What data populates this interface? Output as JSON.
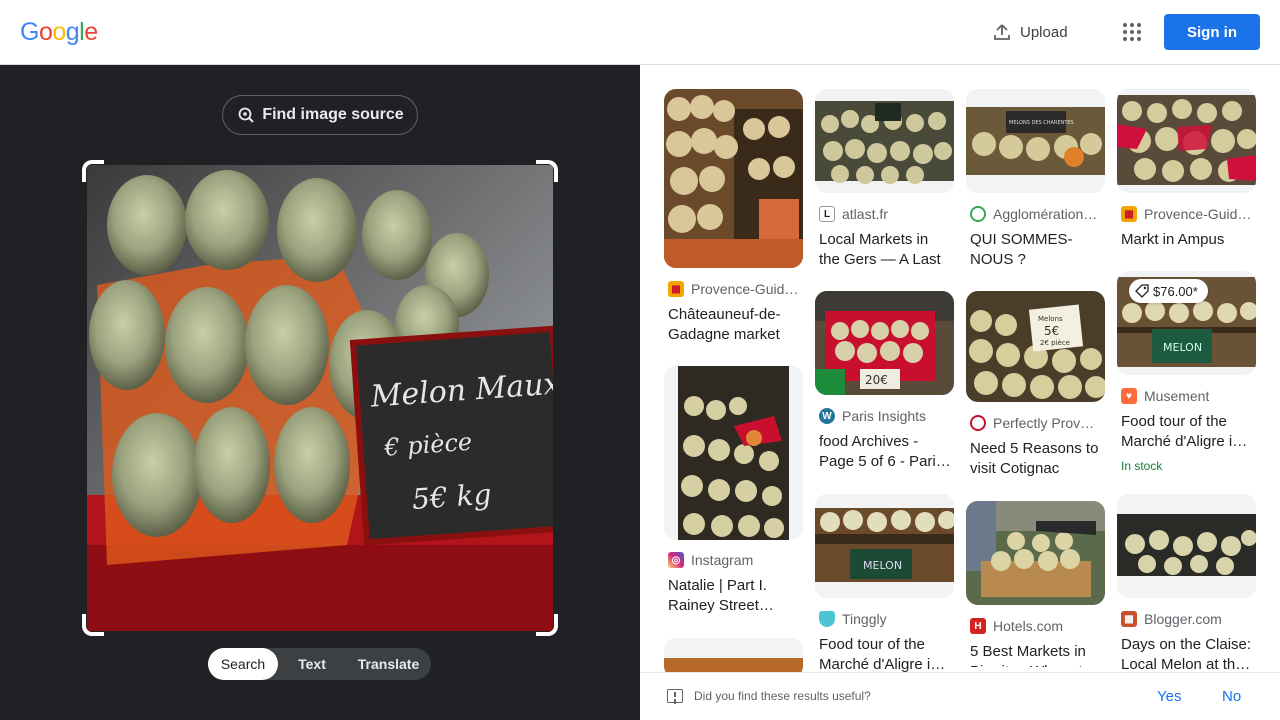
{
  "header": {
    "logo_letters": [
      "G",
      "o",
      "o",
      "g",
      "l",
      "e"
    ],
    "logo_colors": [
      "#4285f4",
      "#ea4335",
      "#fbbc05",
      "#4285f4",
      "#34a853",
      "#ea4335"
    ],
    "upload_label": "Upload",
    "signin_label": "Sign in",
    "accent": "#1a73e8"
  },
  "viewer": {
    "find_source_label": "Find image source",
    "tabs": [
      "Search",
      "Text",
      "Translate"
    ],
    "active_tab": "Search",
    "sign_text": [
      "Melon Maux",
      "€ pièce",
      "5€ kg"
    ]
  },
  "results": [
    {
      "source": "Provence-Guid…",
      "title": "Châteauneuf-de-Gadagne market",
      "favicon": "provence-guide-icon"
    },
    {
      "source": "atlast.fr",
      "title": "Local Markets in the Gers — A Last",
      "favicon": "atlast-icon"
    },
    {
      "source": "Agglomération…",
      "title": "QUI SOMMES-NOUS ?",
      "favicon": "agglomeration-icon"
    },
    {
      "source": "Provence-Guid…",
      "title": "Markt in Ampus",
      "favicon": "provence-guide-icon"
    },
    {
      "source": "Paris Insights",
      "title": "food Archives - Page 5 of 6 - Pari…",
      "favicon": "wordpress-icon"
    },
    {
      "source": "Perfectly Prov…",
      "title": "Need 5 Reasons to visit Cotignac",
      "favicon": "perfectly-provence-icon"
    },
    {
      "source": "Musement",
      "title": "Food tour of the Marché d'Aligre i…",
      "favicon": "musement-heart-icon",
      "price": "$76.00*",
      "stock": "In stock"
    },
    {
      "source": "Instagram",
      "title": "Natalie | Part I. Rainey Street…",
      "favicon": "instagram-icon"
    },
    {
      "source": "Tinggly",
      "title": "Food tour of the Marché d'Aligre i…",
      "favicon": "tinggly-icon"
    },
    {
      "source": "Hotels.com",
      "title": "5 Best Markets in Biarritz - Where t…",
      "favicon": "hotels-icon"
    },
    {
      "source": "Blogger.com",
      "title": "Days on the Claise: Local Melon at th…",
      "favicon": "blogger-icon"
    }
  ],
  "thumb_signs": {
    "r3": "MELONS DES CHARENTES",
    "r6": [
      "Melons",
      "5€",
      "2€ pièce"
    ],
    "r7": "MELON",
    "r5": "20€",
    "r9": "MELON"
  },
  "feedback": {
    "question": "Did you find these results useful?",
    "yes": "Yes",
    "no": "No"
  }
}
